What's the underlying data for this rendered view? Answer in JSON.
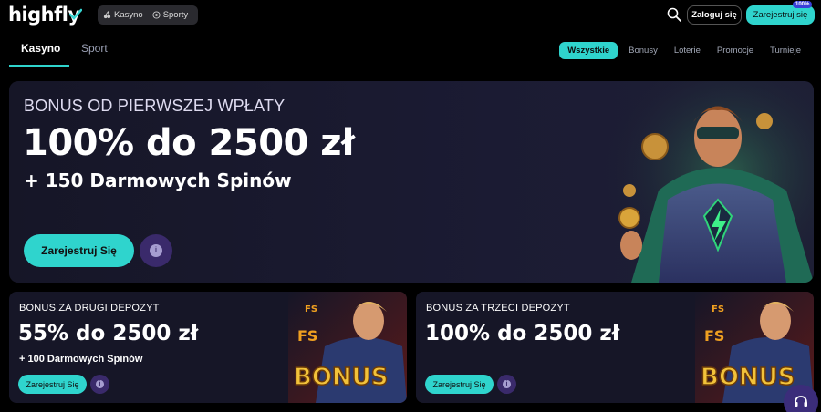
{
  "header": {
    "logo_text": "highfly",
    "modes": [
      {
        "label": "Kasyno",
        "icon": "cherries-icon"
      },
      {
        "label": "Sporty",
        "icon": "soccer-ball-icon"
      }
    ],
    "search_icon": "search-icon",
    "login_label": "Zaloguj się",
    "register_label": "Zarejestruj się",
    "register_badge": "100%"
  },
  "nav": {
    "tabs": [
      {
        "label": "Kasyno",
        "active": true
      },
      {
        "label": "Sport",
        "active": false
      }
    ],
    "filters": [
      {
        "label": "Wszystkie",
        "active": true
      },
      {
        "label": "Bonusy",
        "active": false
      },
      {
        "label": "Loterie",
        "active": false
      },
      {
        "label": "Promocje",
        "active": false
      },
      {
        "label": "Turnieje",
        "active": false
      }
    ]
  },
  "hero": {
    "kicker": "BONUS OD PIERWSZEJ WPŁATY",
    "title": "100% do 2500 zł",
    "subtitle": "+ 150 Darmowych Spinów",
    "button_label": "Zarejestruj Się"
  },
  "cards": [
    {
      "kicker": "BONUS ZA DRUGI DEPOZYT",
      "title": "55% do 2500 zł",
      "subtitle": "+ 100 Darmowych Spinów",
      "button_label": "Zarejestruj Się",
      "art_text": "BONUS",
      "art_badge": "FS"
    },
    {
      "kicker": "BONUS ZA TRZECI DEPOZYT",
      "title": "100% do 2500 zł",
      "subtitle": "",
      "button_label": "Zarejestruj Się",
      "art_text": "BONUS",
      "art_badge": "FS"
    }
  ],
  "colors": {
    "accent": "#2fd4cd",
    "info_button": "#3a2a6b",
    "card_bg": "#161627"
  },
  "support_icon": "headset-icon"
}
